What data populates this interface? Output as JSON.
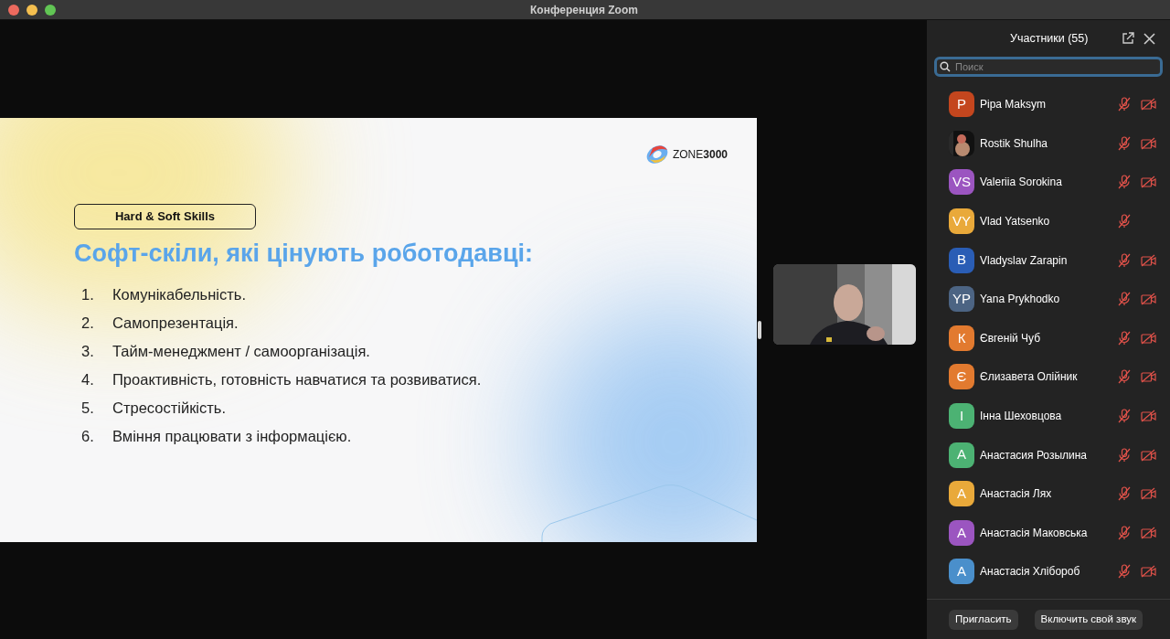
{
  "window": {
    "title": "Конференция Zoom"
  },
  "slide": {
    "logo": "ZONE**3000**",
    "badge": "Hard & Soft Skills",
    "title": "Софт-скіли, які цінують роботодавці:",
    "items": [
      {
        "number": "1.",
        "text": "Комунікабельність."
      },
      {
        "number": "2.",
        "text": "Самопрезентація."
      },
      {
        "number": "3.",
        "text": "Тайм-менеджмент / самоорганізація."
      },
      {
        "number": "4.",
        "text": "Проактивність, готовність навчатися та розвиватися."
      },
      {
        "number": "5.",
        "text": "Стресостійкість."
      },
      {
        "number": "6.",
        "text": "Вміння працювати з інформацією."
      }
    ]
  },
  "participants_panel": {
    "title": "Участники (55)",
    "search": {
      "placeholder": "Поиск"
    },
    "participants": [
      {
        "name": "Pipa Maksym",
        "avatar": {
          "kind": "initials",
          "initials": "P",
          "color": "#c4461e"
        },
        "mic_muted": true,
        "camera_off": true
      },
      {
        "name": "Rostik Shulha",
        "mic_muted": true,
        "camera_off": true
      },
      {
        "name": "Valeriia Sorokina",
        "avatar": {
          "kind": "initials",
          "initials": "VS",
          "color": "#9b55c0"
        },
        "mic_muted": true,
        "camera_off": true
      },
      {
        "name": "Vlad Yatsenko",
        "avatar": {
          "kind": "initials",
          "initials": "VY",
          "color": "#e9a93a"
        },
        "mic_muted": true,
        "camera_off": false
      },
      {
        "name": "Vladyslav Zarapin",
        "avatar": {
          "kind": "initials",
          "initials": "B",
          "color": "#2a5db5"
        },
        "mic_muted": true,
        "camera_off": true
      },
      {
        "name": "Yana Prykhodko",
        "avatar": {
          "kind": "initials",
          "initials": "YP",
          "color": "#4c6483"
        },
        "mic_muted": true,
        "camera_off": true
      },
      {
        "name": "Євгеній Чуб",
        "avatar": {
          "kind": "initials",
          "initials": "К",
          "color": "#e27a2f"
        },
        "mic_muted": true,
        "camera_off": true
      },
      {
        "name": "Єлизавета Олійник",
        "avatar": {
          "kind": "initials",
          "initials": "Є",
          "color": "#e27a2f"
        },
        "mic_muted": true,
        "camera_off": true
      },
      {
        "name": "Інна Шеховцова",
        "avatar": {
          "kind": "initials",
          "initials": "І",
          "color": "#4cb273"
        },
        "mic_muted": true,
        "camera_off": true
      },
      {
        "name": "Анастасия Розылина",
        "avatar": {
          "kind": "initials",
          "initials": "А",
          "color": "#4cb273"
        },
        "mic_muted": true,
        "camera_off": true
      },
      {
        "name": "Анастасія Лях",
        "avatar": {
          "kind": "initials",
          "initials": "А",
          "color": "#e9a93a"
        },
        "mic_muted": true,
        "camera_off": true
      },
      {
        "name": "Анастасія Маковська",
        "avatar": {
          "kind": "initials",
          "initials": "А",
          "color": "#9b55c0"
        },
        "mic_muted": true,
        "camera_off": true
      },
      {
        "name": "Анастасія Хлібороб",
        "avatar": {
          "kind": "initials",
          "initials": "А",
          "color": "#4a8fcb"
        },
        "mic_muted": true,
        "camera_off": true
      }
    ],
    "buttons": [
      "Пригласить",
      "Включить свой звук"
    ]
  }
}
